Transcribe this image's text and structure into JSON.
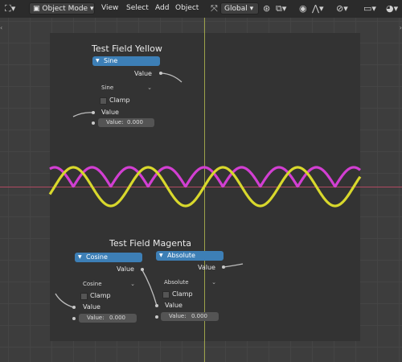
{
  "header": {
    "mode_label": "Object Mode",
    "menu": [
      "View",
      "Select",
      "Add",
      "Object"
    ],
    "transform_orientation": "Global"
  },
  "colors": {
    "sine_curve": "#d8d82c",
    "cosine_curve": "#d23fd2",
    "node_header": "#3d7fb6",
    "x_axis": "#b04a62",
    "y_axis": "#9da24a"
  },
  "node_yellow": {
    "title": "Test Field Yellow",
    "header_label": "Sine",
    "output_label": "Value",
    "dropdown": "Sine",
    "clamp_label": "Clamp",
    "input_label": "Value",
    "field_label": "Value:",
    "field_value": "0.000"
  },
  "node_magenta": {
    "title": "Test Field Magenta",
    "cosine": {
      "header_label": "Cosine",
      "output_label": "Value",
      "dropdown": "Cosine",
      "clamp_label": "Clamp",
      "input_label": "Value",
      "field_label": "Value:",
      "field_value": "0.000"
    },
    "absolute": {
      "header_label": "Absolute",
      "output_label": "Value",
      "dropdown": "Absolute",
      "clamp_label": "Clamp",
      "input_label": "Value",
      "field_label": "Value:",
      "field_value": "0.000"
    }
  }
}
